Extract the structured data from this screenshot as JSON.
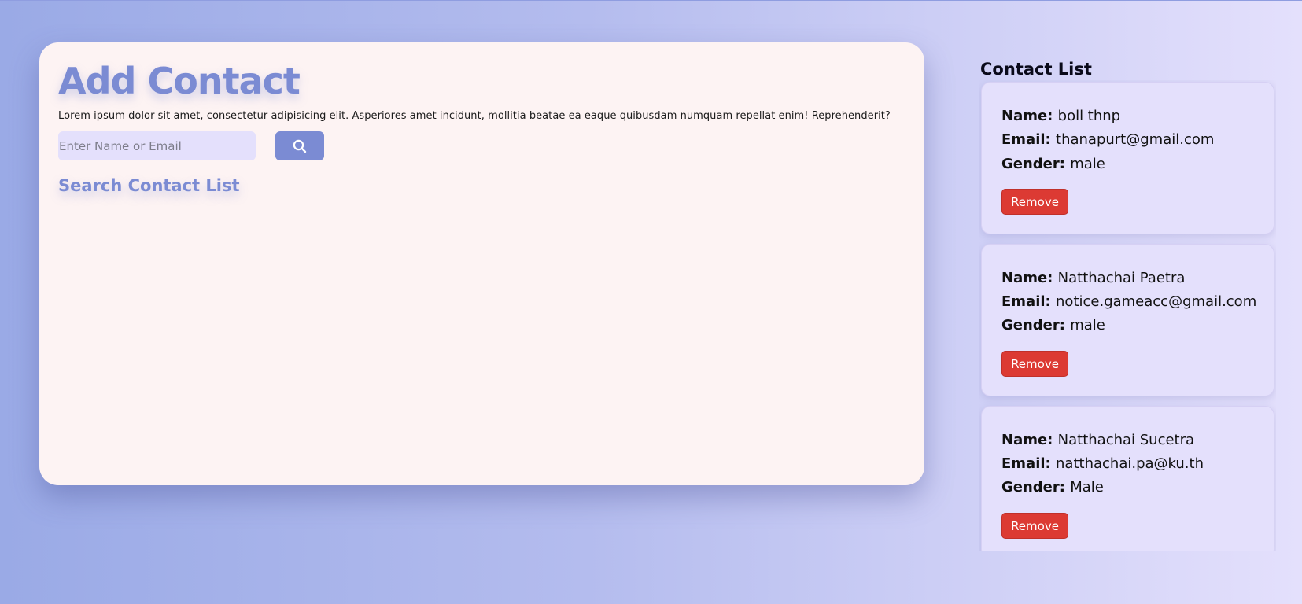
{
  "add_contact": {
    "title": "Add Contact",
    "description": "Lorem ipsum dolor sit amet, consectetur adipisicing elit. Asperiores amet incidunt, mollitia beatae ea eaque quibusdam numquam repellat enim! Reprehenderit?",
    "search_placeholder": "Enter Name or Email",
    "search_value": "",
    "search_icon": "search-icon",
    "search_list_title": "Search Contact List"
  },
  "contact_list": {
    "title": "Contact List",
    "name_label": "Name:",
    "email_label": "Email:",
    "gender_label": "Gender:",
    "remove_label": "Remove",
    "items": [
      {
        "name": "boll thnp",
        "email": "thanapurt@gmail.com",
        "gender": "male"
      },
      {
        "name": "Natthachai Paetra",
        "email": "notice.gameacc@gmail.com",
        "gender": "male"
      },
      {
        "name": "Natthachai Sucetra",
        "email": "natthachai.pa@ku.th",
        "gender": "Male"
      }
    ]
  },
  "colors": {
    "accent": "#7b8bd3",
    "card_bg": "#fdf3f3",
    "contact_bg": "#e4e0fc",
    "remove_red": "#dc3a33"
  }
}
